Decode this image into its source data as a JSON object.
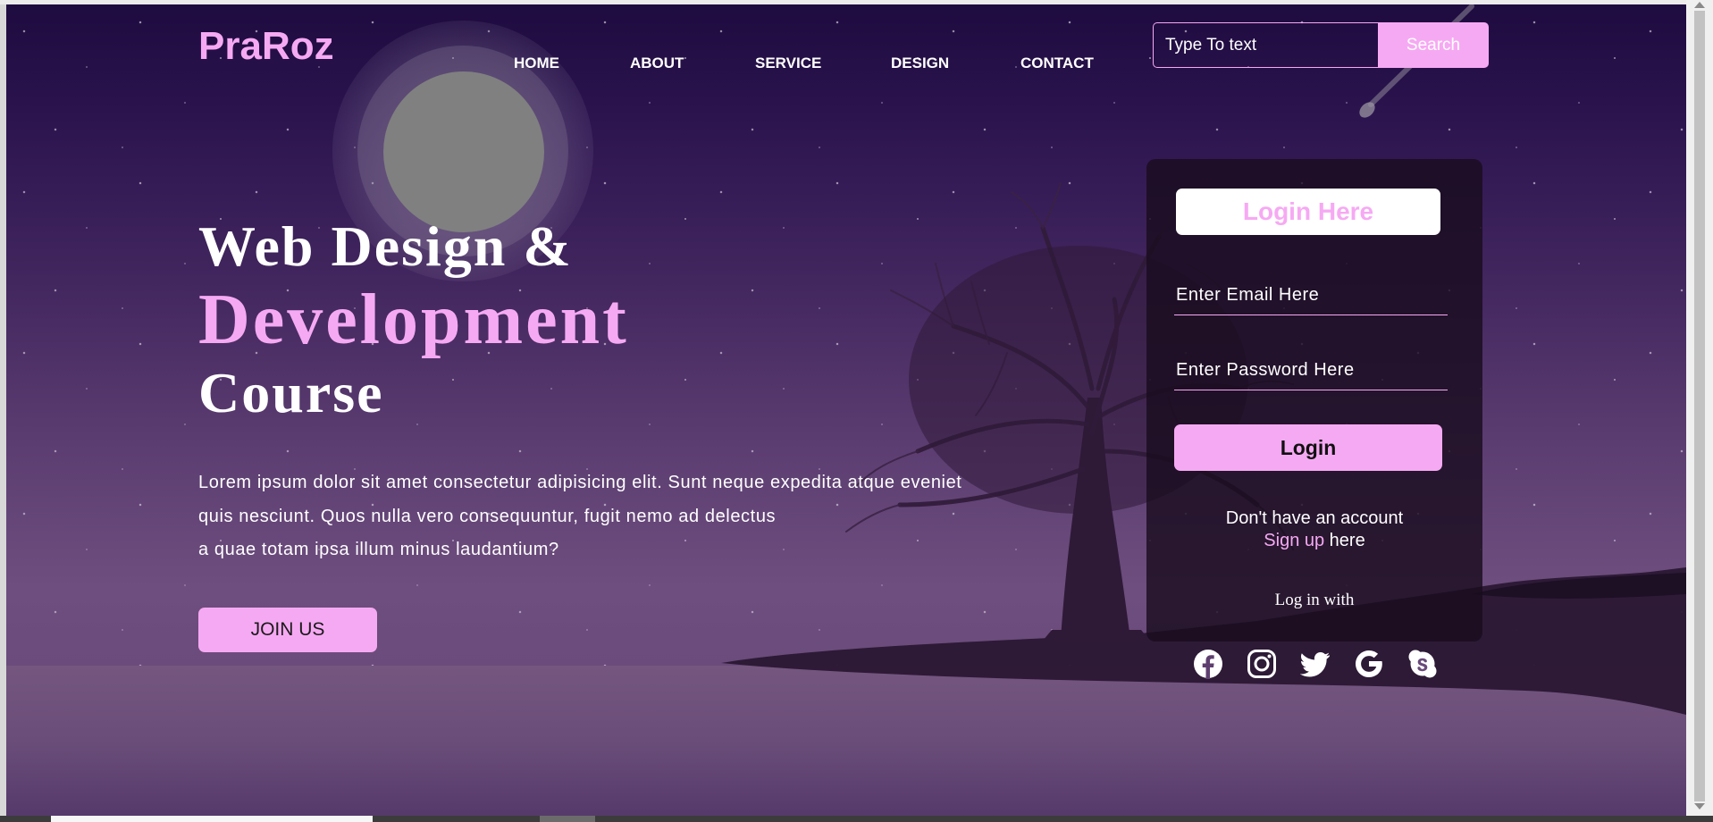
{
  "header": {
    "logo": "PraRoz",
    "nav": [
      "HOME",
      "ABOUT",
      "SERVICE",
      "DESIGN",
      "CONTACT"
    ],
    "search": {
      "placeholder": "Type To text",
      "button_label": "Search"
    }
  },
  "hero": {
    "line1": "Web Design &",
    "line2": "Development",
    "line3": "Course",
    "paragraph": [
      "Lorem ipsum dolor sit amet consectetur adipisicing elit. Sunt neque expedita atque eveniet",
      "quis nesciunt. Quos nulla vero consequuntur, fugit nemo ad delectus",
      "a quae totam ipsa illum minus laudantium?"
    ],
    "cta_label": "JOIN US"
  },
  "login": {
    "title": "Login Here",
    "email_placeholder": "Enter Email Here",
    "password_placeholder": "Enter Password Here",
    "button_label": "Login",
    "no_account_text": "Don't have an account",
    "signup_link": "Sign up",
    "signup_suffix": " here",
    "login_with": "Log in with",
    "social_icons": [
      "facebook-icon",
      "instagram-icon",
      "twitter-icon",
      "google-icon",
      "skype-icon"
    ]
  },
  "colors": {
    "accent": "#f6a9f3",
    "text": "#ffffff",
    "sky_top": "#1e0b3f",
    "card_bg": "#1a0c1e"
  }
}
